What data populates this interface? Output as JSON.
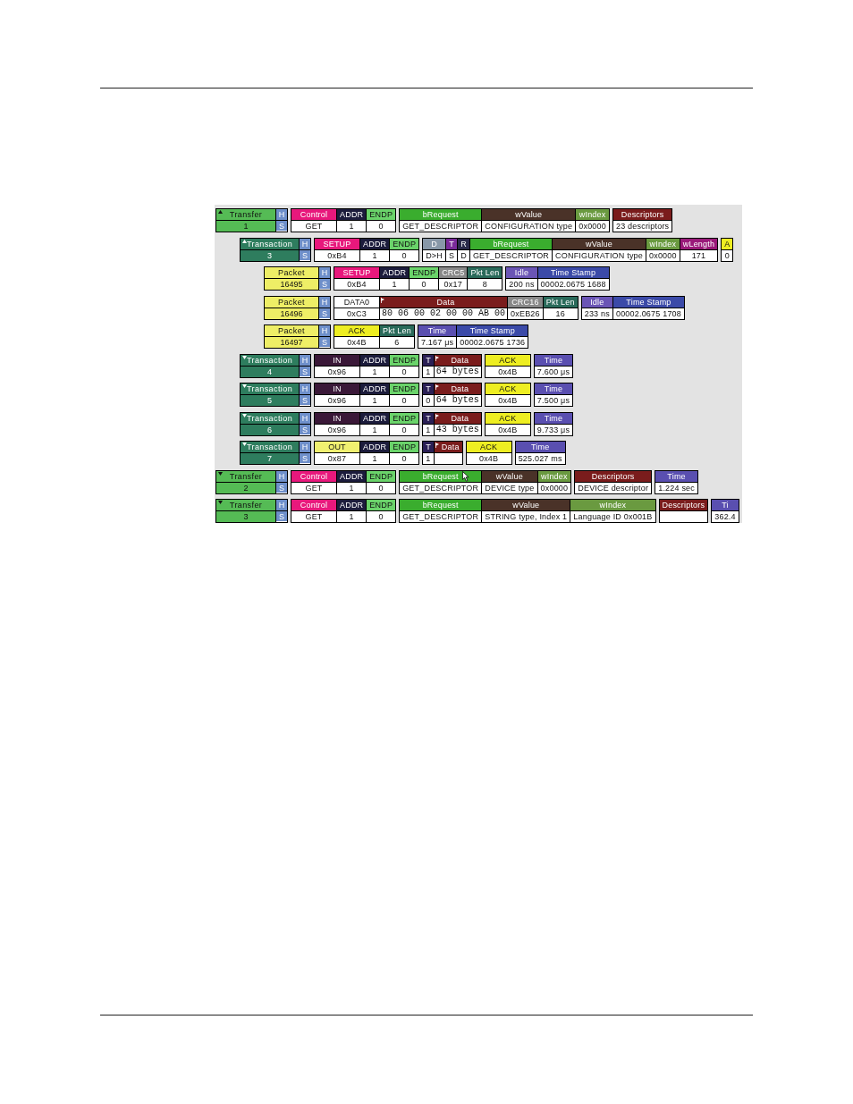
{
  "trace": {
    "transfers": [
      {
        "kind": "transfer",
        "label": "Transfer",
        "number": "1",
        "expanded": true,
        "h": "H",
        "s": "S",
        "groups": [
          [
            {
              "kind": "plain",
              "header": "Control",
              "value": "GET",
              "color": "#e8187c"
            },
            {
              "kind": "plain",
              "header": "ADDR",
              "value": "1",
              "color": "#1c1c3c"
            },
            {
              "kind": "plain",
              "header": "ENDP",
              "value": "0",
              "color": "#6ad36a"
            }
          ],
          [
            {
              "kind": "plain",
              "header": "bRequest",
              "value": "GET_DESCRIPTOR",
              "color": "#3aad2e"
            },
            {
              "kind": "plain",
              "header": "wValue",
              "value": "CONFIGURATION type",
              "color": "#4a3228"
            },
            {
              "kind": "plain",
              "header": "wIndex",
              "value": "0x0000",
              "color": "#6a9a40"
            }
          ],
          [
            {
              "kind": "plain",
              "header": "Descriptors",
              "value": "23 descriptors",
              "color": "#7a1c1c"
            }
          ]
        ],
        "children": [
          {
            "kind": "transaction",
            "label": "Transaction",
            "number": "3",
            "expanded": true,
            "h": "H",
            "s": "S",
            "groups": [
              [
                {
                  "kind": "plain",
                  "header": "SETUP",
                  "value": "0xB4",
                  "color": "#e8187c"
                },
                {
                  "kind": "plain",
                  "header": "ADDR",
                  "value": "1",
                  "color": "#1c1c3c"
                },
                {
                  "kind": "plain",
                  "header": "ENDP",
                  "value": "0",
                  "color": "#6ad36a"
                }
              ],
              [
                {
                  "kind": "plain",
                  "header": "D",
                  "value": "D>H",
                  "color": "#8898a8"
                },
                {
                  "kind": "plain",
                  "header": "T",
                  "value": "S",
                  "color": "#7b2b9b"
                },
                {
                  "kind": "plain",
                  "header": "R",
                  "value": "D",
                  "color": "#2a2a4a"
                },
                {
                  "kind": "plain",
                  "header": "bRequest",
                  "value": "GET_DESCRIPTOR",
                  "color": "#3aad2e"
                },
                {
                  "kind": "plain",
                  "header": "wValue",
                  "value": "CONFIGURATION type",
                  "color": "#4a3228"
                },
                {
                  "kind": "plain",
                  "header": "wIndex",
                  "value": "0x0000",
                  "color": "#6a9a40"
                },
                {
                  "kind": "plain",
                  "header": "wLength",
                  "value": "171",
                  "color": "#9a1a7a"
                }
              ],
              [
                {
                  "kind": "plain",
                  "header": "A",
                  "value": "0",
                  "color": "#eeee22"
                }
              ]
            ],
            "children": [
              {
                "kind": "packet",
                "label": "Packet",
                "number": "16495",
                "h": "H",
                "s": "S",
                "groups": [
                  [
                    {
                      "kind": "plain",
                      "header": "SETUP",
                      "value": "0xB4",
                      "color": "#e8187c"
                    },
                    {
                      "kind": "plain",
                      "header": "ADDR",
                      "value": "1",
                      "color": "#1c1c3c"
                    },
                    {
                      "kind": "plain",
                      "header": "ENDP",
                      "value": "0",
                      "color": "#6ad36a"
                    },
                    {
                      "kind": "plain",
                      "header": "CRC5",
                      "value": "0x17",
                      "color": "#888888"
                    },
                    {
                      "kind": "plain",
                      "header": "Pkt Len",
                      "value": "8",
                      "color": "#2a6a5a"
                    }
                  ],
                  [
                    {
                      "kind": "plain",
                      "header": "Idle",
                      "value": "200 ns",
                      "color": "#6a55b5"
                    },
                    {
                      "kind": "plain",
                      "header": "Time Stamp",
                      "value": "00002.0675 1688",
                      "color": "#3b4aa8"
                    }
                  ]
                ]
              },
              {
                "kind": "packet",
                "label": "Packet",
                "number": "16496",
                "h": "H",
                "s": "S",
                "groups": [
                  [
                    {
                      "kind": "plain",
                      "header": "DATA0",
                      "value": "0xC3",
                      "color": "#ffffff"
                    },
                    {
                      "kind": "data",
                      "header": "Data",
                      "value": "80 06 00 02 00 00 AB 00",
                      "color": "#7a1c1c"
                    },
                    {
                      "kind": "plain",
                      "header": "CRC16",
                      "value": "0xEB26",
                      "color": "#888888"
                    },
                    {
                      "kind": "plain",
                      "header": "Pkt Len",
                      "value": "16",
                      "color": "#2a6a5a"
                    }
                  ],
                  [
                    {
                      "kind": "plain",
                      "header": "Idle",
                      "value": "233 ns",
                      "color": "#6a55b5"
                    },
                    {
                      "kind": "plain",
                      "header": "Time Stamp",
                      "value": "00002.0675 1708",
                      "color": "#3b4aa8"
                    }
                  ]
                ]
              },
              {
                "kind": "packet",
                "label": "Packet",
                "number": "16497",
                "h": "H",
                "s": "S",
                "groups": [
                  [
                    {
                      "kind": "plain",
                      "header": "ACK",
                      "value": "0x4B",
                      "color": "#eeee22"
                    },
                    {
                      "kind": "plain",
                      "header": "Pkt Len",
                      "value": "6",
                      "color": "#2a6a5a"
                    }
                  ],
                  [
                    {
                      "kind": "plain",
                      "header": "Time",
                      "value": "7.167 μs",
                      "color": "#5a4fb0"
                    },
                    {
                      "kind": "plain",
                      "header": "Time Stamp",
                      "value": "00002.0675 1736",
                      "color": "#3b4aa8"
                    }
                  ]
                ]
              }
            ]
          },
          {
            "kind": "transaction",
            "label": "Transaction",
            "number": "4",
            "expanded": false,
            "h": "H",
            "s": "S",
            "groups": [
              [
                {
                  "kind": "plain",
                  "header": "IN",
                  "value": "0x96",
                  "color": "#3a1838"
                },
                {
                  "kind": "plain",
                  "header": "ADDR",
                  "value": "1",
                  "color": "#1c1c3c"
                },
                {
                  "kind": "plain",
                  "header": "ENDP",
                  "value": "0",
                  "color": "#6ad36a"
                }
              ],
              [
                {
                  "kind": "plain",
                  "header": "T",
                  "value": "1",
                  "color": "#2a1f55"
                },
                {
                  "kind": "data",
                  "header": "Data",
                  "value": "64 bytes",
                  "color": "#7a1c1c"
                }
              ],
              [
                {
                  "kind": "plain",
                  "header": "ACK",
                  "value": "0x4B",
                  "color": "#eeee22"
                }
              ],
              [
                {
                  "kind": "plain",
                  "header": "Time",
                  "value": "7.600 μs",
                  "color": "#5a4fb0"
                }
              ]
            ]
          },
          {
            "kind": "transaction",
            "label": "Transaction",
            "number": "5",
            "expanded": false,
            "h": "H",
            "s": "S",
            "groups": [
              [
                {
                  "kind": "plain",
                  "header": "IN",
                  "value": "0x96",
                  "color": "#3a1838"
                },
                {
                  "kind": "plain",
                  "header": "ADDR",
                  "value": "1",
                  "color": "#1c1c3c"
                },
                {
                  "kind": "plain",
                  "header": "ENDP",
                  "value": "0",
                  "color": "#6ad36a"
                }
              ],
              [
                {
                  "kind": "plain",
                  "header": "T",
                  "value": "0",
                  "color": "#2a1f55"
                },
                {
                  "kind": "data",
                  "header": "Data",
                  "value": "64 bytes",
                  "color": "#7a1c1c"
                }
              ],
              [
                {
                  "kind": "plain",
                  "header": "ACK",
                  "value": "0x4B",
                  "color": "#eeee22"
                }
              ],
              [
                {
                  "kind": "plain",
                  "header": "Time",
                  "value": "7.500 μs",
                  "color": "#5a4fb0"
                }
              ]
            ]
          },
          {
            "kind": "transaction",
            "label": "Transaction",
            "number": "6",
            "expanded": false,
            "h": "H",
            "s": "S",
            "groups": [
              [
                {
                  "kind": "plain",
                  "header": "IN",
                  "value": "0x96",
                  "color": "#3a1838"
                },
                {
                  "kind": "plain",
                  "header": "ADDR",
                  "value": "1",
                  "color": "#1c1c3c"
                },
                {
                  "kind": "plain",
                  "header": "ENDP",
                  "value": "0",
                  "color": "#6ad36a"
                }
              ],
              [
                {
                  "kind": "plain",
                  "header": "T",
                  "value": "1",
                  "color": "#2a1f55"
                },
                {
                  "kind": "data",
                  "header": "Data",
                  "value": "43 bytes",
                  "color": "#7a1c1c"
                }
              ],
              [
                {
                  "kind": "plain",
                  "header": "ACK",
                  "value": "0x4B",
                  "color": "#eeee22"
                }
              ],
              [
                {
                  "kind": "plain",
                  "header": "Time",
                  "value": "9.733 μs",
                  "color": "#5a4fb0"
                }
              ]
            ]
          },
          {
            "kind": "transaction",
            "label": "Transaction",
            "number": "7",
            "expanded": false,
            "h": "H",
            "s": "S",
            "groups": [
              [
                {
                  "kind": "plain",
                  "header": "OUT",
                  "value": "0x87",
                  "color": "#f0f070"
                },
                {
                  "kind": "plain",
                  "header": "ADDR",
                  "value": "1",
                  "color": "#1c1c3c"
                },
                {
                  "kind": "plain",
                  "header": "ENDP",
                  "value": "0",
                  "color": "#6ad36a"
                }
              ],
              [
                {
                  "kind": "plain",
                  "header": "T",
                  "value": "1",
                  "color": "#2a1f55"
                },
                {
                  "kind": "data",
                  "header": "Data",
                  "color": "#7a1c1c"
                }
              ],
              [
                {
                  "kind": "plain",
                  "header": "ACK",
                  "value": "0x4B",
                  "color": "#eeee22"
                }
              ],
              [
                {
                  "kind": "plain",
                  "header": "Time",
                  "value": "525.027 ms",
                  "color": "#5a4fb0"
                }
              ]
            ]
          }
        ]
      },
      {
        "kind": "transfer",
        "label": "Transfer",
        "number": "2",
        "expanded": false,
        "h": "H",
        "s": "S",
        "groups": [
          [
            {
              "kind": "plain",
              "header": "Control",
              "value": "GET",
              "color": "#e8187c"
            },
            {
              "kind": "plain",
              "header": "ADDR",
              "value": "1",
              "color": "#1c1c3c"
            },
            {
              "kind": "plain",
              "header": "ENDP",
              "value": "0",
              "color": "#6ad36a"
            }
          ],
          [
            {
              "kind": "plain",
              "header": "bRequest",
              "value": "GET_DESCRIPTOR",
              "color": "#3aad2e"
            },
            {
              "kind": "plain",
              "header": "wValue",
              "value": "DEVICE type",
              "color": "#4a3228"
            },
            {
              "kind": "plain",
              "header": "wIndex",
              "value": "0x0000",
              "color": "#6a9a40"
            }
          ],
          [
            {
              "kind": "plain",
              "header": "Descriptors",
              "value": "DEVICE descriptor",
              "color": "#7a1c1c"
            }
          ],
          [
            {
              "kind": "plain",
              "header": "Time",
              "value": "1.224 sec",
              "color": "#5a4fb0"
            }
          ]
        ]
      },
      {
        "kind": "transfer",
        "label": "Transfer",
        "number": "3",
        "expanded": false,
        "h": "H",
        "s": "S",
        "groups": [
          [
            {
              "kind": "plain",
              "header": "Control",
              "value": "GET",
              "color": "#e8187c"
            },
            {
              "kind": "plain",
              "header": "ADDR",
              "value": "1",
              "color": "#1c1c3c"
            },
            {
              "kind": "plain",
              "header": "ENDP",
              "value": "0",
              "color": "#6ad36a"
            }
          ],
          [
            {
              "kind": "plain",
              "header": "bRequest",
              "value": "GET_DESCRIPTOR",
              "color": "#3aad2e"
            },
            {
              "kind": "plain",
              "header": "wValue",
              "value": "STRING type, Index 1",
              "color": "#4a3228"
            },
            {
              "kind": "plain",
              "header": "wIndex",
              "value": "Language ID 0x001B",
              "color": "#6a9a40"
            }
          ],
          [
            {
              "kind": "plain",
              "header": "Descriptors",
              "color": "#7a1c1c"
            }
          ],
          [
            {
              "kind": "plain",
              "header": "Ti",
              "value": "362.4",
              "color": "#5a4fb0"
            }
          ]
        ]
      }
    ]
  }
}
